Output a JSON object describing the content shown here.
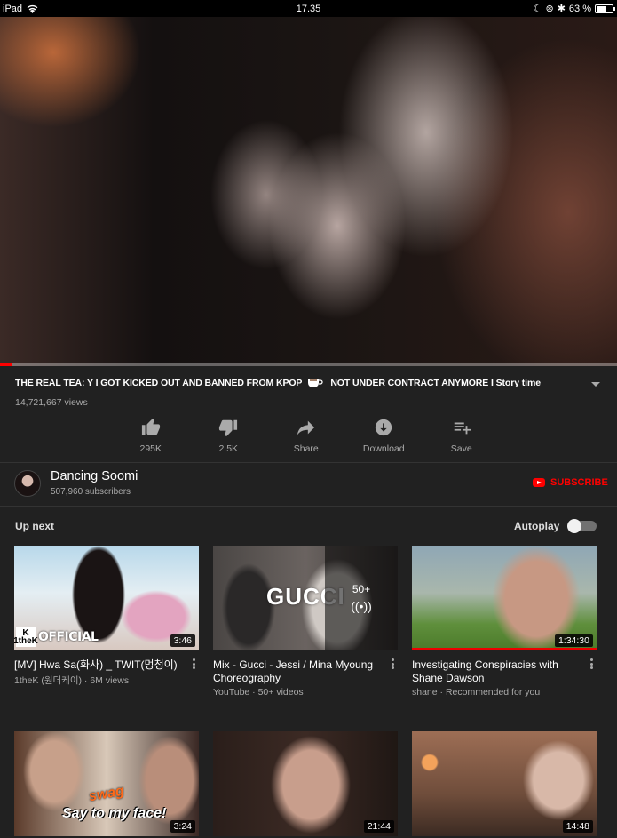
{
  "status_bar": {
    "device": "iPad",
    "time": "17.35",
    "battery": "63 %",
    "battery_level": 0.63
  },
  "player": {
    "progress_played": 0.02
  },
  "video": {
    "title_part1": "THE REAL TEA: Y I GOT KICKED OUT AND BANNED FROM KPOP",
    "title_part2": "NOT UNDER CONTRACT ANYMORE I Story time",
    "views": "14,721,667 views"
  },
  "actions": [
    {
      "label": "295K",
      "icon": "thumbs-up-icon"
    },
    {
      "label": "2.5K",
      "icon": "thumbs-down-icon"
    },
    {
      "label": "Share",
      "icon": "share-icon"
    },
    {
      "label": "Download",
      "icon": "download-icon"
    },
    {
      "label": "Save",
      "icon": "playlist-add-icon"
    }
  ],
  "channel": {
    "name": "Dancing Soomi",
    "subscribers": "507,960 subscribers",
    "subscribe_label": "SUBSCRIBE"
  },
  "up_next": {
    "heading": "Up next",
    "autoplay_label": "Autoplay",
    "autoplay_on": false
  },
  "cards": [
    {
      "title": "[MV] Hwa Sa(화사) _ TWIT(멍청이)",
      "meta": "1theK (원더케이) · 6M views",
      "duration": "3:46",
      "badge_k": "1theK",
      "badge_text": "OFFICIAL"
    },
    {
      "title": "Mix - Gucci - Jessi / Mina Myoung Choreography",
      "meta": "YouTube · 50+ videos",
      "overlay_count": "50+",
      "overlay_text": "GUCCI"
    },
    {
      "title": "Investigating Conspiracies with Shane Dawson",
      "meta": "shane · Recommended for you",
      "duration": "1:34:30"
    },
    {
      "duration": "3:24",
      "overlay_swag": "swag",
      "overlay_say": "Say to my face!"
    },
    {
      "duration": "21:44"
    },
    {
      "duration": "14:48"
    }
  ],
  "colors": {
    "background": "#212121",
    "accent": "#ff0000",
    "secondary_text": "#aaaaaa"
  }
}
